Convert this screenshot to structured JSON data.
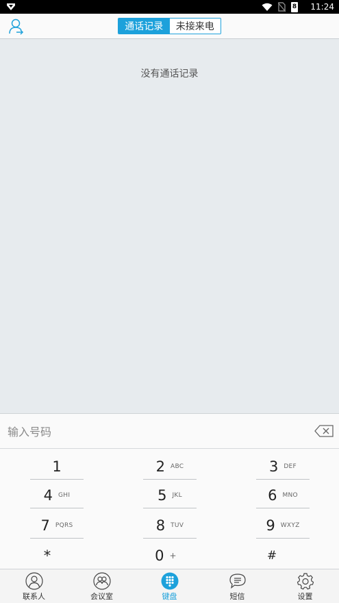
{
  "statusbar": {
    "time": "11:24",
    "battery": "8"
  },
  "header": {
    "tabs": [
      {
        "label": "通话记录",
        "active": true
      },
      {
        "label": "未接来电",
        "active": false
      }
    ]
  },
  "content": {
    "empty_text": "没有通话记录"
  },
  "dialpad": {
    "input_placeholder": "输入号码",
    "input_value": "",
    "keys": [
      {
        "digit": "1",
        "letters": ""
      },
      {
        "digit": "2",
        "letters": "ABC"
      },
      {
        "digit": "3",
        "letters": "DEF"
      },
      {
        "digit": "4",
        "letters": "GHI"
      },
      {
        "digit": "5",
        "letters": "JKL"
      },
      {
        "digit": "6",
        "letters": "MNO"
      },
      {
        "digit": "7",
        "letters": "PQRS"
      },
      {
        "digit": "8",
        "letters": "TUV"
      },
      {
        "digit": "9",
        "letters": "WXYZ"
      },
      {
        "digit": "*",
        "letters": ""
      },
      {
        "digit": "0",
        "letters": "+"
      },
      {
        "digit": "#",
        "letters": ""
      }
    ]
  },
  "nav": {
    "items": [
      {
        "label": "联系人",
        "icon": "contacts-icon",
        "active": false
      },
      {
        "label": "会议室",
        "icon": "meeting-room-icon",
        "active": false
      },
      {
        "label": "键盘",
        "icon": "keypad-icon",
        "active": true
      },
      {
        "label": "短信",
        "icon": "message-icon",
        "active": false
      },
      {
        "label": "设置",
        "icon": "settings-icon",
        "active": false
      }
    ]
  },
  "colors": {
    "accent": "#1da1db",
    "background": "#e7ebee",
    "statusbar": "#000000"
  }
}
